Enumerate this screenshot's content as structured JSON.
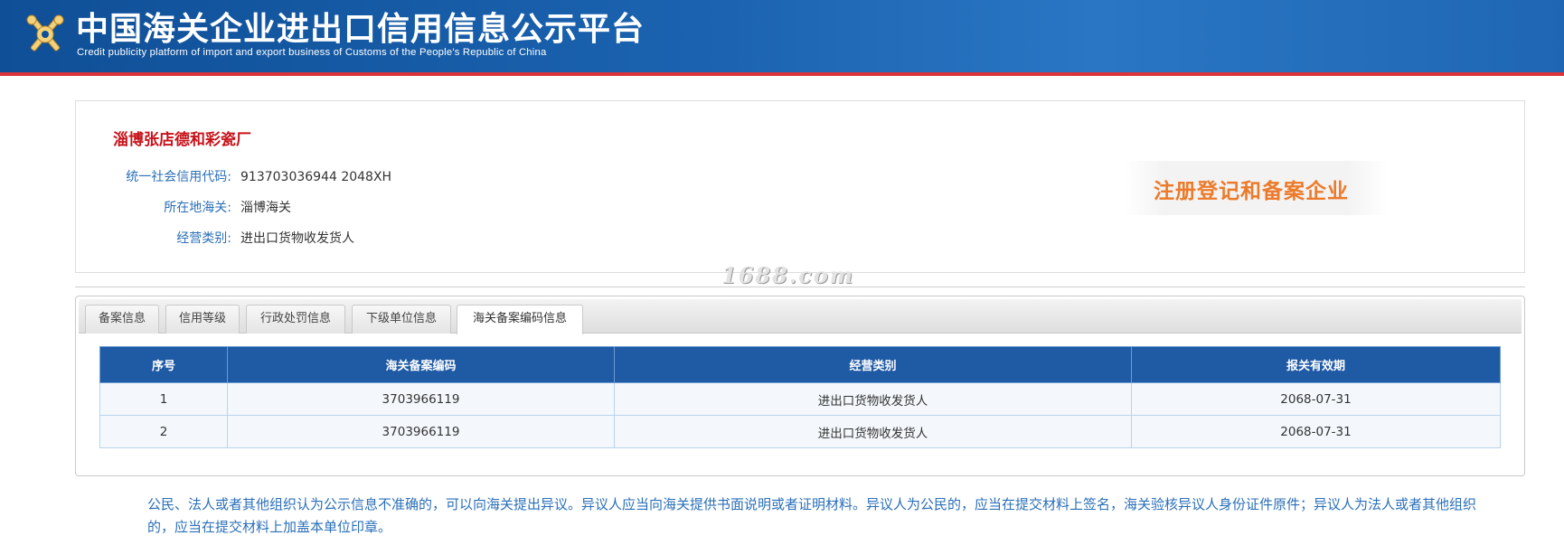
{
  "header": {
    "title": "中国海关企业进出口信用信息公示平台",
    "subtitle": "Credit publicity platform of import and export business of Customs of the People's Republic of China"
  },
  "company": {
    "name": "淄博张店德和彩瓷厂",
    "fields": [
      {
        "label": "统一社会信用代码:",
        "value": "913703036944 2048XH"
      },
      {
        "label": "所在地海关:",
        "value": "淄博海关"
      },
      {
        "label": "经营类别:",
        "value": "进出口货物收发货人"
      }
    ],
    "stamp": "注册登记和备案企业"
  },
  "watermark": "1688.com",
  "tabs": [
    {
      "label": "备案信息",
      "active": false
    },
    {
      "label": "信用等级",
      "active": false
    },
    {
      "label": "行政处罚信息",
      "active": false
    },
    {
      "label": "下级单位信息",
      "active": false
    },
    {
      "label": "海关备案编码信息",
      "active": true
    }
  ],
  "table": {
    "headers": [
      "序号",
      "海关备案编码",
      "经营类别",
      "报关有效期"
    ],
    "rows": [
      [
        "1",
        "3703966119",
        "进出口货物收发货人",
        "2068-07-31"
      ],
      [
        "2",
        "3703966119",
        "进出口货物收发货人",
        "2068-07-31"
      ]
    ]
  },
  "notice": "公民、法人或者其他组织认为公示信息不准确的，可以向海关提出异议。异议人应当向海关提供书面说明或者证明材料。异议人为公民的，应当在提交材料上签名，海关验核异议人身份证件原件；异议人为法人或者其他组织的，应当在提交材料上加盖本单位印章。"
}
